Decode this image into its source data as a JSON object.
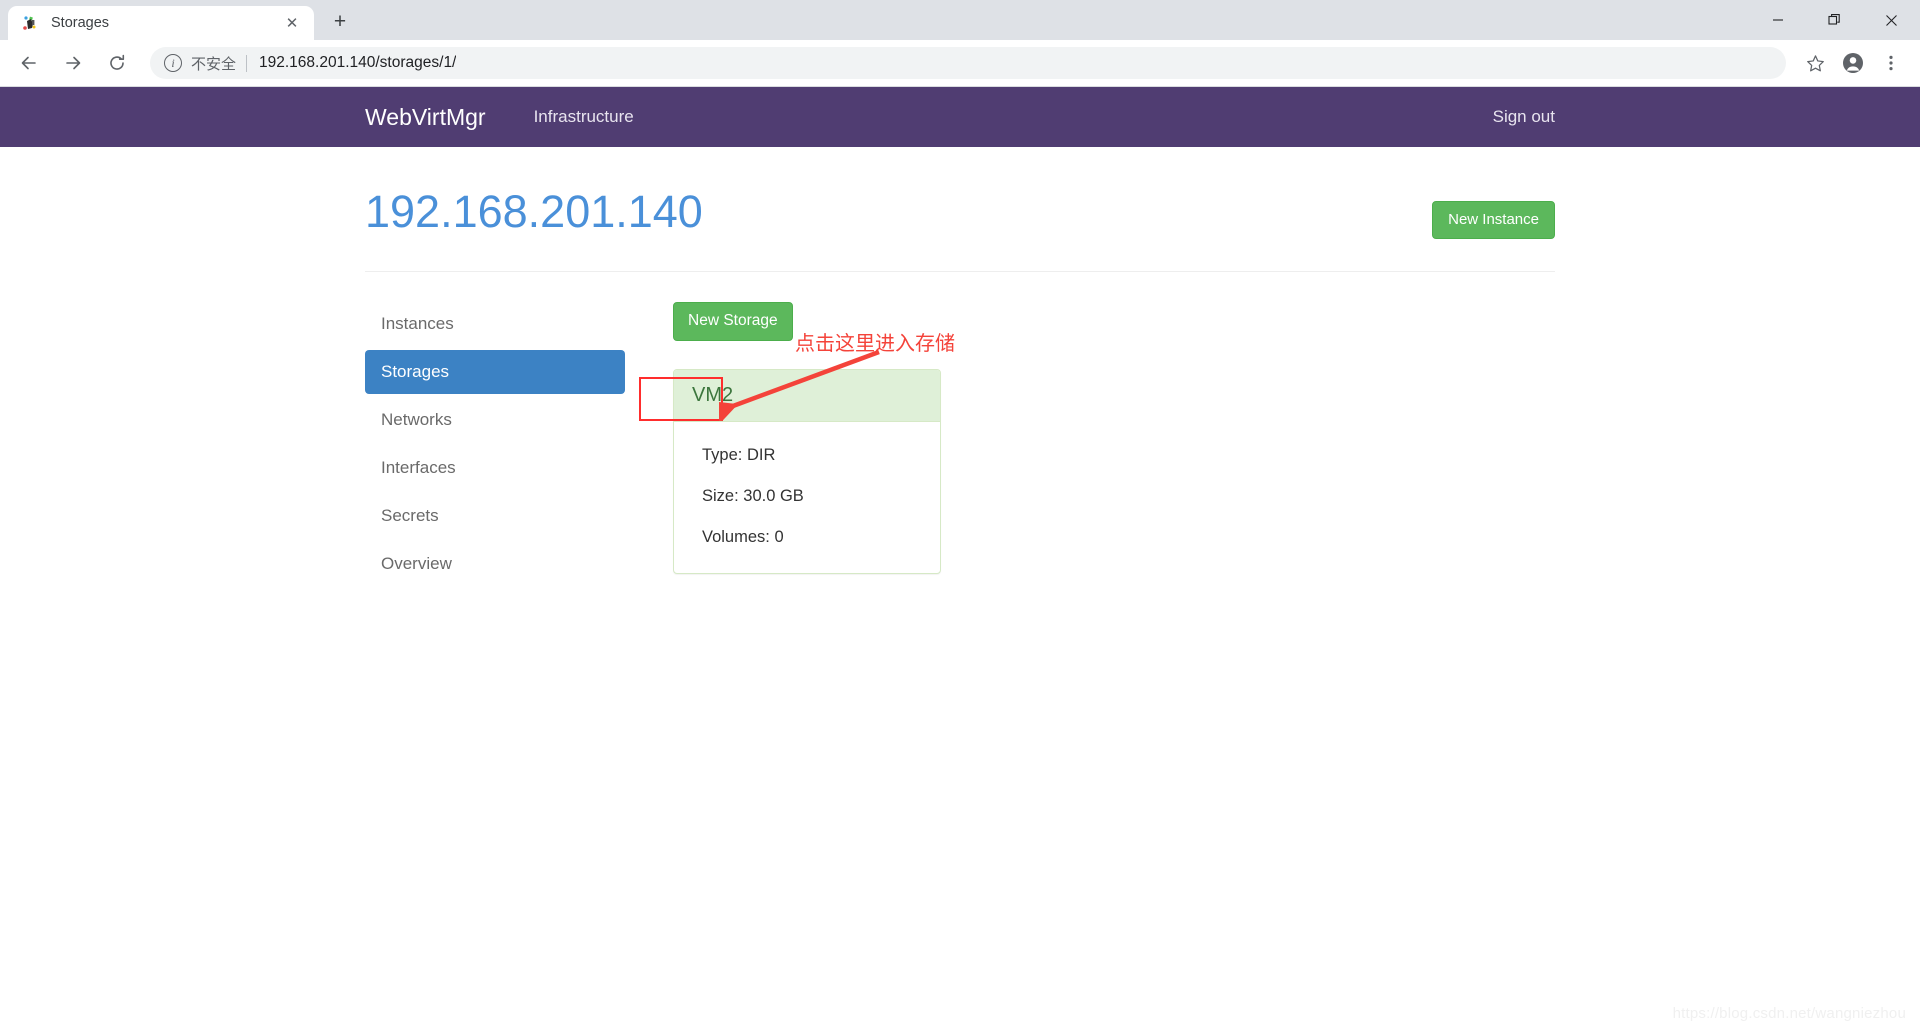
{
  "browser": {
    "tab": {
      "title": "Storages",
      "close_label": "✕",
      "favicon_name": "webvirtmgr-favicon"
    },
    "new_tab_label": "+",
    "window_controls": {
      "minimize": "—",
      "restore": "❐",
      "close": "✕"
    },
    "nav": {
      "back": "←",
      "forward": "→",
      "reload": "⟳"
    },
    "omnibox": {
      "info_glyph": "i",
      "security_label": "不安全",
      "url": "192.168.201.140/storages/1/"
    },
    "actions": {
      "bookmark": "☆",
      "profile": "profile-avatar",
      "menu": "⋮"
    }
  },
  "navbar": {
    "brand": "WebVirtMgr",
    "links": [
      {
        "label": "Infrastructure"
      }
    ],
    "signout_label": "Sign out",
    "background_color": "#503d72"
  },
  "header": {
    "title": "192.168.201.140",
    "title_color": "#4a90d9",
    "new_instance_label": "New Instance",
    "new_instance_color": "#5cb85c"
  },
  "sidebar": {
    "items": [
      {
        "label": "Instances",
        "active": false
      },
      {
        "label": "Storages",
        "active": true
      },
      {
        "label": "Networks",
        "active": false
      },
      {
        "label": "Interfaces",
        "active": false
      },
      {
        "label": "Secrets",
        "active": false
      },
      {
        "label": "Overview",
        "active": false
      }
    ],
    "active_color": "#3c82c4"
  },
  "main": {
    "new_storage_label": "New Storage",
    "storage_card": {
      "name": "VM2",
      "header_bg": "#dff0d8",
      "name_color": "#3c763d",
      "details": [
        {
          "label": "Type",
          "value": "DIR",
          "text": "Type: DIR"
        },
        {
          "label": "Size",
          "value": "30.0 GB",
          "text": "Size: 30.0 GB"
        },
        {
          "label": "Volumes",
          "value": "0",
          "text": "Volumes: 0"
        }
      ]
    }
  },
  "annotation": {
    "text": "点击这里进入存储",
    "color": "#f4433a"
  },
  "watermark": {
    "text": "https://blog.csdn.net/wangniezhou"
  }
}
